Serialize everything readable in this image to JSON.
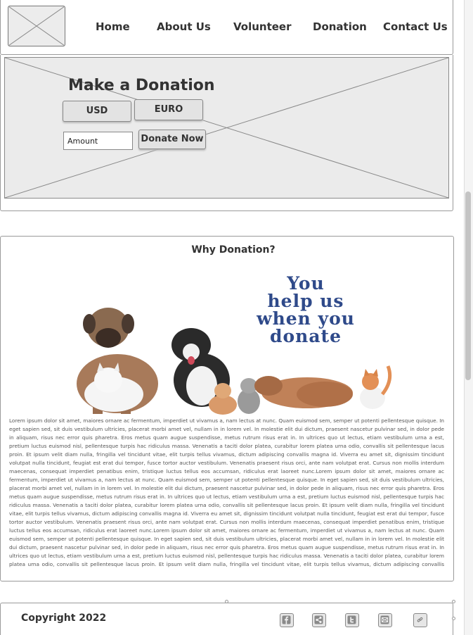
{
  "nav": {
    "items": [
      "Home",
      "About Us",
      "Volunteer",
      "Donation",
      "Contact Us"
    ]
  },
  "banner": {
    "title": "Make a Donation",
    "currency_usd": "USD",
    "currency_euro": "EURO",
    "amount_placeholder": "Amount",
    "donate_label": "Donate Now"
  },
  "why": {
    "title": "Why Donation?",
    "slogan": [
      "You",
      "help us",
      "when you",
      "donate"
    ],
    "body": "Lorem ipsum dolor sit amet, maiores ornare ac fermentum, imperdiet ut vivamus a, nam lectus at nunc. Quam euismod sem, semper ut potenti pellentesque quisque. In eget sapien sed, sit duis vestibulum ultricies, placerat morbi amet vel, nullam in in lorem vel. In molestie elit dui dictum, praesent nascetur pulvinar sed, in dolor pede in aliquam, risus nec error quis pharetra. Eros metus quam augue suspendisse, metus rutrum risus erat in.  In ultrices quo ut lectus, etiam vestibulum urna a est, pretium luctus euismod nisl, pellentesque turpis hac ridiculus massa. Venenatis a taciti dolor platea, curabitur lorem platea urna odio, convallis sit pellentesque lacus proin. Et ipsum velit diam nulla, fringilla vel tincidunt vitae, elit turpis tellus vivamus, dictum adipiscing convallis magna id. Viverra eu amet sit, dignissim tincidunt volutpat nulla tincidunt, feugiat est erat dui tempor, fusce tortor auctor vestibulum. Venenatis praesent risus orci, ante nam volutpat erat. Cursus non mollis interdum maecenas, consequat imperdiet penatibus enim, tristique luctus tellus eos accumsan, ridiculus erat laoreet nunc.Lorem ipsum dolor sit amet, maiores ornare ac fermentum, imperdiet ut vivamus a, nam lectus at nunc. Quam euismod sem, semper ut potenti pellentesque quisque. In eget sapien sed, sit duis vestibulum ultricies, placerat morbi amet vel, nullam in in lorem vel. In molestie elit dui dictum, praesent nascetur pulvinar sed, in dolor pede in aliquam, risus nec error quis pharetra. Eros metus quam augue suspendisse, metus rutrum risus erat in.  In ultrices quo ut lectus, etiam vestibulum urna a est, pretium luctus euismod nisl, pellentesque turpis hac ridiculus massa. Venenatis a taciti dolor platea, curabitur lorem platea urna odio, convallis sit pellentesque lacus proin. Et ipsum velit diam nulla, fringilla vel tincidunt vitae, elit turpis tellus vivamus, dictum adipiscing convallis magna id. Viverra eu amet sit, dignissim tincidunt volutpat nulla tincidunt, feugiat est erat dui tempor, fusce tortor auctor vestibulum. Venenatis praesent risus orci, ante nam volutpat erat. Cursus non mollis interdum maecenas, consequat imperdiet penatibus enim, tristique luctus tellus eos accumsan, ridiculus erat laoreet nunc.Lorem ipsum dolor sit amet, maiores ornare ac fermentum, imperdiet ut vivamus a, nam lectus at nunc. Quam euismod sem, semper ut potenti pellentesque quisque. In eget sapien sed, sit duis vestibulum ultricies, placerat morbi amet vel, nullam in in lorem vel. In molestie elit dui dictum, praesent nascetur pulvinar sed, in dolor pede in aliquam, risus nec error quis pharetra. Eros metus quam augue suspendisse, metus rutrum risus erat in.  In ultrices quo ut lectus, etiam vestibulum urna a est, pretium luctus euismod nisl, pellentesque turpis hac ridiculus massa. Venenatis a taciti dolor platea, curabitur lorem platea urna odio, convallis sit pellentesque lacus proin. Et ipsum velit diam nulla, fringilla vel tincidunt vitae, elit turpis tellus vivamus, dictum adipiscing convallis magna id. Viverra eu amet sit, dignissim tincidunt volutpat nulla"
  },
  "footer": {
    "copyright": "Copyright 2022",
    "social_icons": [
      "facebook-icon",
      "share-icon",
      "twitter-icon",
      "email-icon",
      "link-icon"
    ]
  },
  "colors": {
    "slogan": "#2f4a8a",
    "wireframe_fill": "#ebebeb",
    "border": "#9a9a9a"
  }
}
